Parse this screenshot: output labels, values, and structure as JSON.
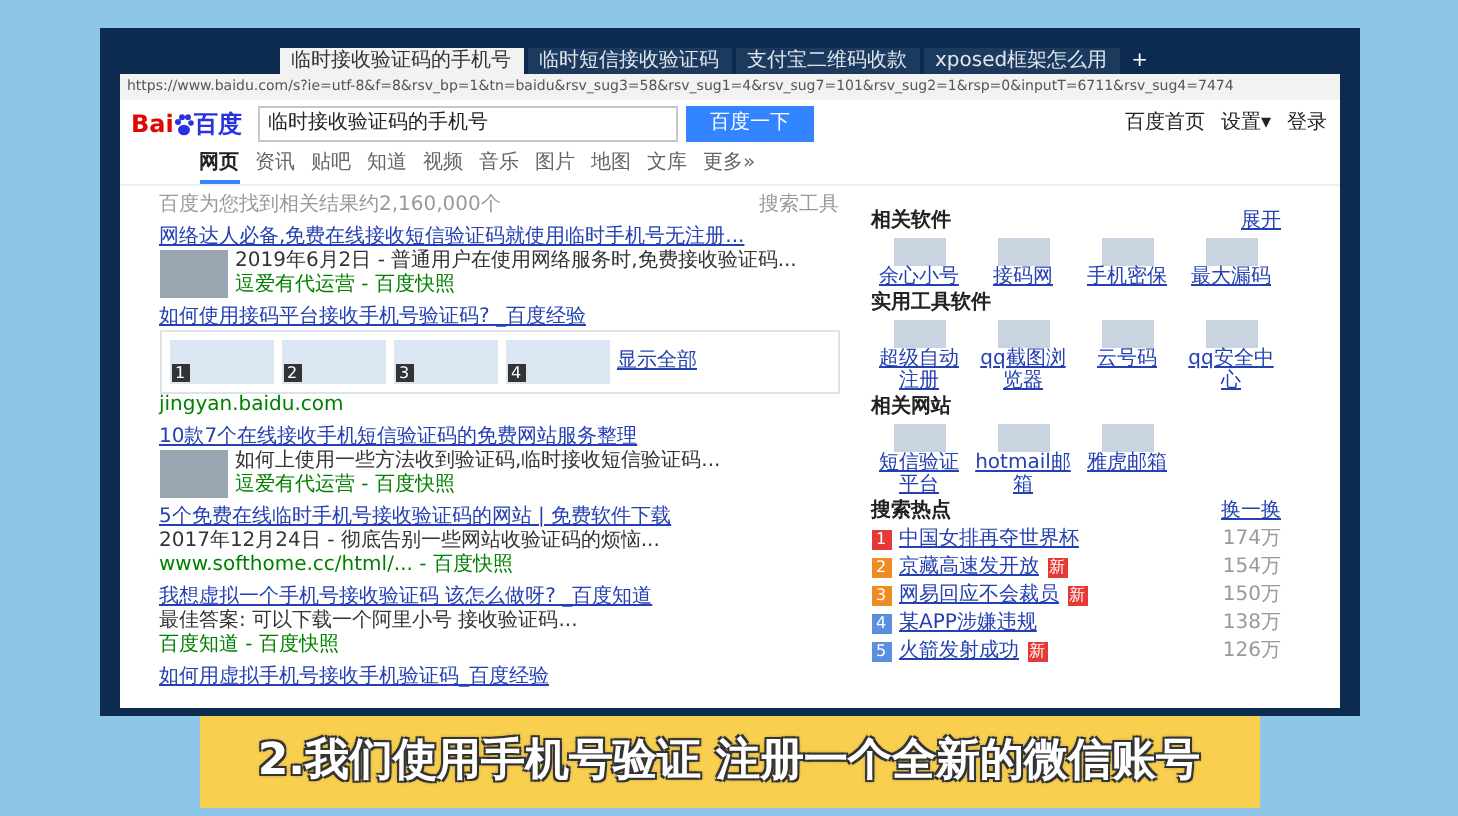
{
  "browser": {
    "tabs": [
      {
        "title": "临时接收验证码的手机号",
        "selected": true
      },
      {
        "title": "临时短信接收验证码",
        "selected": false
      },
      {
        "title": "支付宝二维码收款",
        "selected": false
      },
      {
        "title": "xposed框架怎么用",
        "selected": false
      }
    ],
    "new_tab": "+",
    "address": "https://www.baidu.com/s?ie=utf-8&f=8&rsv_bp=1&tn=baidu&rsv_sug3=58&rsv_sug1=4&rsv_sug7=101&rsv_sug2=1&rsp=0&inputT=6711&rsv_sug4=7474",
    "logo": {
      "latin": "Bai",
      "chinese": "百度"
    },
    "search": {
      "query": "临时接收验证码的手机号",
      "button": "百度一下"
    },
    "top_links": [
      "百度首页",
      "设置▾",
      "登录"
    ],
    "nav": [
      {
        "label": "网页",
        "selected": true
      },
      {
        "label": "资讯",
        "selected": false
      },
      {
        "label": "贴吧",
        "selected": false
      },
      {
        "label": "知道",
        "selected": false
      },
      {
        "label": "视频",
        "selected": false
      },
      {
        "label": "音乐",
        "selected": false
      },
      {
        "label": "图片",
        "selected": false
      },
      {
        "label": "地图",
        "selected": false
      },
      {
        "label": "文库",
        "selected": false
      },
      {
        "label": "更多»",
        "selected": false
      }
    ]
  },
  "result_count": "百度为您找到相关结果约2,160,000个",
  "search_tools": "搜索工具",
  "results": [
    {
      "kind": "thumb",
      "title": "网络达人必备,免费在线接收短信验证码就使用临时手机号无注册...",
      "snippet": "2019年6月2日 - 普通用户在使用网络服务时,免费接收验证码...",
      "source": "逗爱有代运营 - 百度快照"
    },
    {
      "kind": "steps",
      "title": "如何使用接码平台接收手机号验证码? _百度经验",
      "steps": [
        "1",
        "2",
        "3",
        "4"
      ],
      "more": "显示全部",
      "source": "jingyan.baidu.com"
    },
    {
      "kind": "thumb",
      "title": "10款7个在线接收手机短信验证码的免费网站服务整理",
      "snippet": "如何上使用一些方法收到验证码,临时接收短信验证码...",
      "source": "逗爱有代运营 - 百度快照"
    },
    {
      "kind": "plain",
      "title": "5个免费在线临时手机号接收验证码的网站 | 免费软件下载",
      "snippet": "2017年12月24日 - 彻底告别一些网站收验证码的烦恼...",
      "source": "www.softhome.cc/html/... - 百度快照"
    },
    {
      "kind": "plain",
      "title": "我想虚拟一个手机号接收验证码 该怎么做呀? _百度知道",
      "snippet": "最佳答案: 可以下载一个阿里小号 接收验证码...",
      "source": "百度知道 - 百度快照"
    },
    {
      "kind": "plain",
      "title": "如何用虚拟手机号接收手机验证码_百度经验"
    }
  ],
  "sidebar": [
    {
      "kind": "apps",
      "title": "相关软件",
      "action": "展开",
      "items": [
        "余心小号",
        "接码网",
        "手机密保",
        "最大漏码"
      ]
    },
    {
      "kind": "apps",
      "title": "实用工具软件",
      "items": [
        "超级自动注册",
        "qq截图浏览器",
        "云号码",
        "qq安全中心"
      ]
    },
    {
      "kind": "apps",
      "title": "相关网站",
      "items": [
        "短信验证平台",
        "hotmail邮箱",
        "雅虎邮箱"
      ]
    },
    {
      "kind": "hot",
      "title": "搜索热点",
      "action": "换一换",
      "items": [
        {
          "rank": "1",
          "name": "中国女排再夺世界杯",
          "count": "174万",
          "color": "#e53935"
        },
        {
          "rank": "2",
          "name": "京藏高速发开放",
          "count": "154万",
          "color": "#f08a24",
          "badge": "新"
        },
        {
          "rank": "3",
          "name": "网易回应不会裁员",
          "count": "150万",
          "color": "#f08a24",
          "badge": "新"
        },
        {
          "rank": "4",
          "name": "某APP涉嫌违规",
          "count": "138万",
          "color": "#5b8fe0"
        },
        {
          "rank": "5",
          "name": "火箭发射成功",
          "count": "126万",
          "color": "#5b8fe0",
          "badge": "新"
        }
      ]
    }
  ],
  "subtitle": "2.我们使用手机号验证 注册一个全新的微信账号"
}
